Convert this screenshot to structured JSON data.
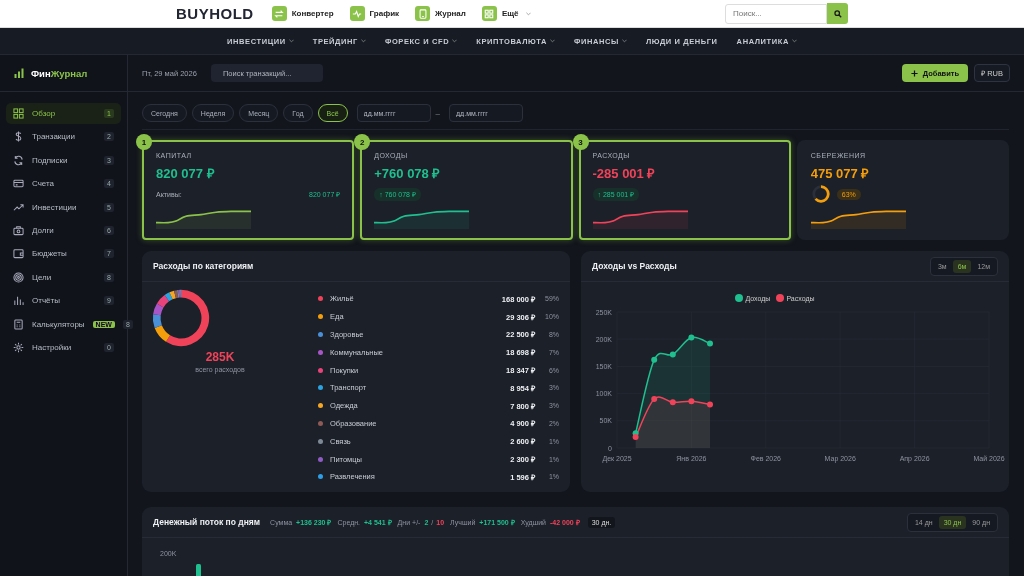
{
  "topbar": {
    "logo": "BUYHOLD",
    "links": [
      {
        "label": "Конвертер",
        "has_menu": false
      },
      {
        "label": "График",
        "has_menu": false
      },
      {
        "label": "Журнал",
        "has_menu": false
      },
      {
        "label": "Ещё",
        "has_menu": true
      }
    ],
    "search": {
      "placeholder": "Поиск..."
    }
  },
  "nav": [
    {
      "label": "ИНВЕСТИЦИИ",
      "has_menu": true
    },
    {
      "label": "ТРЕЙДИНГ",
      "has_menu": true
    },
    {
      "label": "ФОРЕКС И CFD",
      "has_menu": true
    },
    {
      "label": "КРИПТОВАЛЮТА",
      "has_menu": true
    },
    {
      "label": "ФИНАНСЫ",
      "has_menu": true
    },
    {
      "label": "ЛЮДИ И ДЕНЬГИ",
      "has_menu": false
    },
    {
      "label": "АНАЛИТИКА",
      "has_menu": true
    }
  ],
  "brand": {
    "prefix": "Фин",
    "accent": "Журнал"
  },
  "sidebar": [
    {
      "label": "Обзор",
      "badge": "1",
      "selected": true
    },
    {
      "label": "Транзакции",
      "badge": "2",
      "selected": false
    },
    {
      "label": "Подписки",
      "badge": "3",
      "selected": false
    },
    {
      "label": "Счета",
      "badge": "4",
      "selected": false
    },
    {
      "label": "Инвестиции",
      "badge": "5",
      "selected": false
    },
    {
      "label": "Долги",
      "badge": "6",
      "selected": false
    },
    {
      "label": "Бюджеты",
      "badge": "7",
      "selected": false
    },
    {
      "label": "Цели",
      "badge": "8",
      "selected": false
    },
    {
      "label": "Отчёты",
      "badge": "9",
      "selected": false
    },
    {
      "label": "Калькуляторы",
      "tag": "NEW",
      "badge": "8",
      "selected": false
    },
    {
      "label": "Настройки",
      "badge": "0",
      "selected": false
    }
  ],
  "header": {
    "date": "Пт, 29 май 2026",
    "search": {
      "placeholder": "Поиск транзакций..."
    },
    "add_button": "Добавить",
    "currency_button": "₽ RUB"
  },
  "periods": [
    {
      "label": "Сегодня",
      "selected": false
    },
    {
      "label": "Неделя",
      "selected": false
    },
    {
      "label": "Месяц",
      "selected": false
    },
    {
      "label": "Год",
      "selected": false
    },
    {
      "label": "Всё",
      "selected": true
    }
  ],
  "date_from": {
    "placeholder": "дд.мм.гггг"
  },
  "date_separator": "–",
  "date_to": {
    "placeholder": "дд.мм.гггг"
  },
  "cards": [
    {
      "kind": "capital",
      "step": "1",
      "highlighted": true,
      "label": "КАПИТАЛ",
      "value": "820 077 ₽",
      "color": "#8bc34a",
      "sub_label": "Активы:",
      "sub_value": "820 077 ₽"
    },
    {
      "kind": "income",
      "step": "2",
      "highlighted": true,
      "label": "ДОХОДЫ",
      "value": "+760 078 ₽",
      "color": "#1fbf8f",
      "badge": "↑ 760 078 ₽"
    },
    {
      "kind": "expense",
      "step": "3",
      "highlighted": true,
      "label": "РАСХОДЫ",
      "value": "-285 001 ₽",
      "color": "#f0435a",
      "badge": "↑ 285 001 ₽"
    },
    {
      "kind": "savings",
      "highlighted": false,
      "label": "СБЕРЕЖЕНИЯ",
      "value": "475 077 ₽",
      "color": "#f59e0b",
      "level": 0.63,
      "badge": "63%"
    }
  ],
  "expenses": {
    "title": "Расходы по категориям",
    "total": "285K",
    "total_label": "всего расходов",
    "chart_data": {
      "type": "donut",
      "values": [
        58.95,
        10.28,
        7.89,
        6.56,
        6.44,
        3.14,
        2.74,
        1.72,
        0.91,
        0.81,
        0.56
      ]
    },
    "items": [
      {
        "name": "Жильё",
        "color": "#f0435a",
        "amount": "168 000 ₽",
        "share": "59%"
      },
      {
        "name": "Еда",
        "color": "#f59e0b",
        "amount": "29 306 ₽",
        "share": "10%"
      },
      {
        "name": "Здоровье",
        "color": "#4a90d9",
        "amount": "22 500 ₽",
        "share": "8%"
      },
      {
        "name": "Коммунальные",
        "color": "#a855c7",
        "amount": "18 698 ₽",
        "share": "7%"
      },
      {
        "name": "Покупки",
        "color": "#e8437a",
        "amount": "18 347 ₽",
        "share": "6%"
      },
      {
        "name": "Транспорт",
        "color": "#2aa3e0",
        "amount": "8 954 ₽",
        "share": "3%"
      },
      {
        "name": "Одежда",
        "color": "#f5a623",
        "amount": "7 800 ₽",
        "share": "3%"
      },
      {
        "name": "Образование",
        "color": "#8d5a55",
        "amount": "4 900 ₽",
        "share": "2%"
      },
      {
        "name": "Связь",
        "color": "#7d8a96",
        "amount": "2 600 ₽",
        "share": "1%"
      },
      {
        "name": "Питомцы",
        "color": "#8e5cc4",
        "amount": "2 300 ₽",
        "share": "1%"
      },
      {
        "name": "Развлечения",
        "color": "#2d9fe6",
        "amount": "1 596 ₽",
        "share": "1%"
      }
    ]
  },
  "trend": {
    "title": "Доходы vs Расходы",
    "ranges": [
      {
        "label": "3м",
        "selected": false
      },
      {
        "label": "6м",
        "selected": true
      },
      {
        "label": "12м",
        "selected": false
      }
    ],
    "chart_data": {
      "type": "area",
      "categories": [
        "Дек 2025",
        null,
        null,
        null,
        "Янв 2026",
        null,
        null,
        null,
        "Фев 2026",
        null,
        null,
        null,
        "Мар 2026",
        null,
        null,
        null,
        "Апр 2026",
        null,
        null,
        null,
        "Май 2026"
      ],
      "series": [
        {
          "name": "Доходы",
          "color": "#1fbf8f",
          "values": [
            null,
            27000,
            162000,
            172000,
            203000,
            192000,
            null,
            null,
            null,
            null,
            null,
            null,
            null,
            null,
            null,
            null,
            null,
            null,
            null,
            null,
            null
          ]
        },
        {
          "name": "Расходы",
          "color": "#f0435a",
          "values": [
            null,
            20000,
            90000,
            84000,
            86000,
            80000,
            null,
            null,
            null,
            null,
            null,
            null,
            null,
            null,
            null,
            null,
            null,
            null,
            null,
            null,
            null
          ]
        }
      ],
      "ylim": [
        0,
        250000
      ],
      "grid": true,
      "yticks": [
        {
          "value": 0,
          "label": "0"
        },
        {
          "value": 50000,
          "label": "50K"
        },
        {
          "value": 100000,
          "label": "100K"
        },
        {
          "value": 150000,
          "label": "150K"
        },
        {
          "value": 200000,
          "label": "200K"
        },
        {
          "value": 250000,
          "label": "250K"
        }
      ]
    }
  },
  "cashflow": {
    "title": "Денежный поток по дням",
    "stats": [
      {
        "kind": "gain",
        "label": "Сумма",
        "value": "+136 230 ₽"
      },
      {
        "kind": "gain",
        "label": "Средн.",
        "value": "+4 541 ₽"
      },
      {
        "kind": "split",
        "label": "Дни +/-",
        "positive": "2",
        "separator": "/",
        "negative": "10"
      },
      {
        "kind": "gain",
        "label": "Лучший",
        "value": "+171 500 ₽"
      },
      {
        "kind": "loss",
        "label": "Худший",
        "value": "-42 000 ₽"
      }
    ],
    "period_badge": "30 дн.",
    "ranges": [
      {
        "label": "14 дн",
        "selected": false
      },
      {
        "label": "30 дн",
        "selected": true
      },
      {
        "label": "90 дн",
        "selected": false
      }
    ],
    "axis_label": "200K"
  }
}
